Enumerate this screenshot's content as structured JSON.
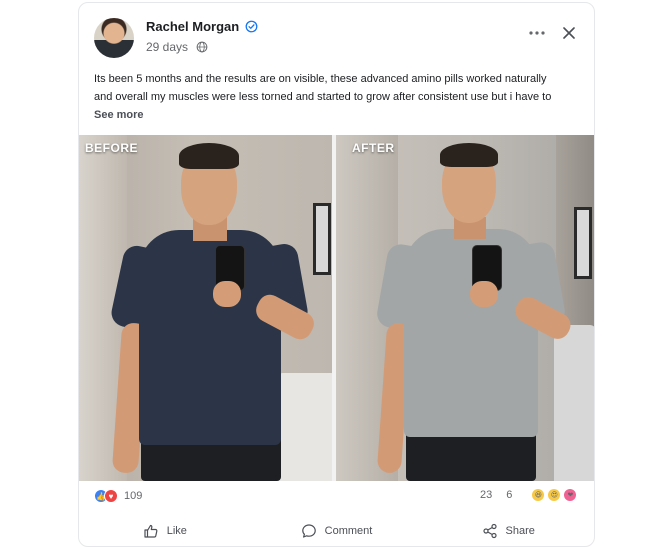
{
  "post": {
    "author": "Rachel Morgan",
    "verified_icon": "verified-badge-icon",
    "time": "29 days",
    "audience_icon": "globe-icon",
    "text_line1": "Its been 5 months and the results are on visible, these advanced amino pills worked naturally",
    "text_line2": "and overall my muscles were less torned and started to grow after consistent use but i have to",
    "see_more": "See more"
  },
  "image": {
    "before_label": "BEFORE",
    "after_label": "AFTER",
    "before_shirt_color": "#2c3547",
    "after_shirt_color": "#a3a6a6"
  },
  "stats": {
    "reaction_count": "109",
    "comment_count": "23",
    "share_count": "6"
  },
  "actions": {
    "like": "Like",
    "comment": "Comment",
    "share": "Share"
  },
  "colors": {
    "verified": "#1877f2",
    "like_reaction": "#3b82f6",
    "love_reaction": "#ef4444"
  }
}
